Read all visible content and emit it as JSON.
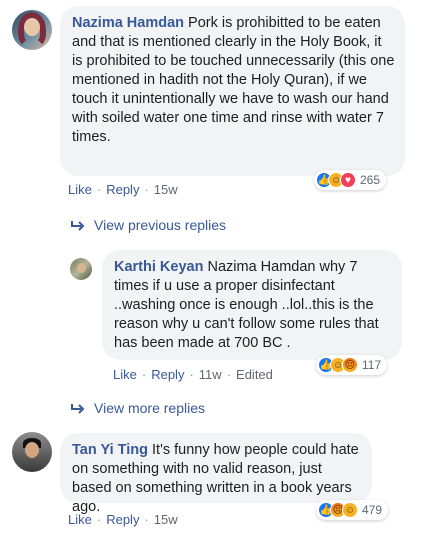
{
  "comments": [
    {
      "author": "Nazima Hamdan",
      "text": "Pork is prohibitted to be eaten and that is mentioned clearly in the Holy Book, it is prohibited to be touched unnecessarily (this one mentioned in hadith not the Holy Quran), if we touch it unintentionally we have to wash our hand with soiled water one time and rinse with water 7 times.",
      "like_label": "Like",
      "reply_label": "Reply",
      "time": "15w",
      "reaction_count": "265",
      "reactions": [
        "like",
        "haha",
        "love"
      ]
    },
    {
      "author": "Karthi Keyan",
      "text": "Nazima Hamdan why 7 times if u use a proper disinfectant ..washing once is enough ..lol..this is the reason why u can't follow some rules that has been made at 700 BC .",
      "like_label": "Like",
      "reply_label": "Reply",
      "time": "11w",
      "edited_label": "Edited",
      "reaction_count": "117",
      "reactions": [
        "like",
        "haha",
        "angry"
      ]
    },
    {
      "author": "Tan Yi Ting",
      "text": "It's funny how people could hate on something with no valid reason, just based on something written in a book years ago.",
      "like_label": "Like",
      "reply_label": "Reply",
      "time": "15w",
      "reaction_count": "479",
      "reactions": [
        "like",
        "angry",
        "haha"
      ]
    }
  ],
  "view_previous_replies": "View previous replies",
  "view_more_replies": "View more replies",
  "colors": {
    "link": "#385898",
    "bubble": "#f2f3f5",
    "meta": "#606770",
    "like": "#1877f2",
    "haha": "#f7b125",
    "love": "#f33e58"
  },
  "icons": [
    "avatar",
    "reply-arrow-icon",
    "like-reaction-icon",
    "haha-reaction-icon",
    "love-reaction-icon",
    "angry-reaction-icon"
  ]
}
